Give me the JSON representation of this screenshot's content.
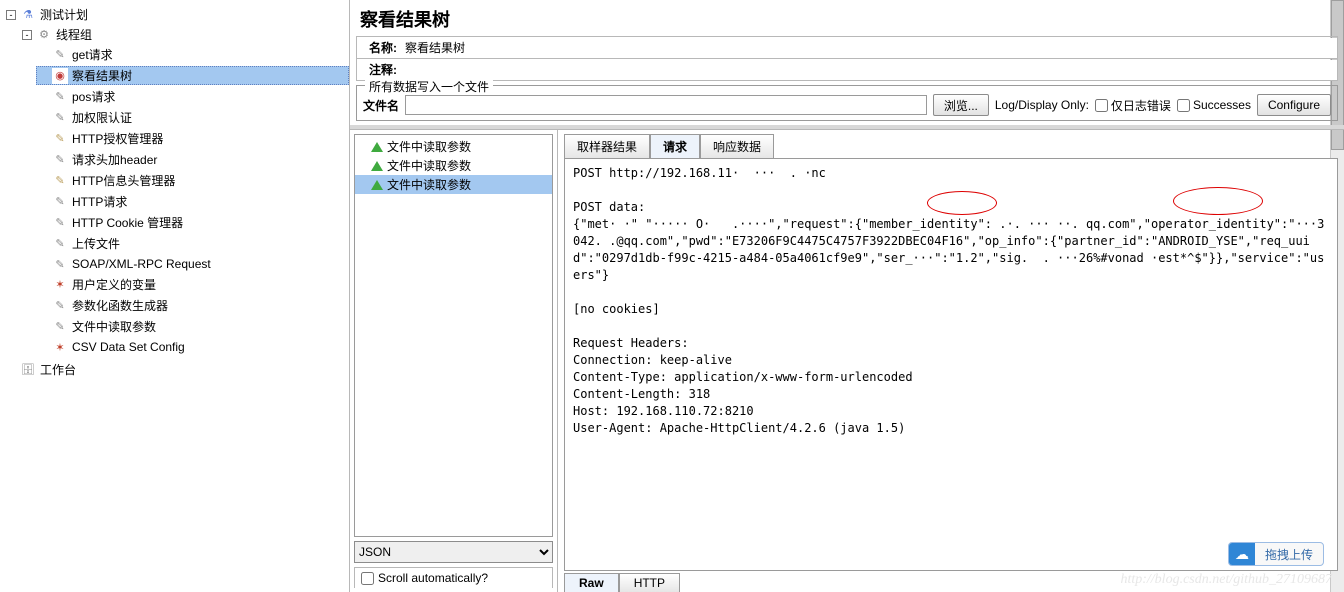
{
  "tree": {
    "root": "测试计划",
    "group": "线程组",
    "items": [
      "get请求",
      "察看结果树",
      "pos请求",
      "加权限认证",
      "HTTP授权管理器",
      "请求头加header",
      "HTTP信息头管理器",
      "HTTP请求",
      "HTTP Cookie 管理器",
      "上传文件",
      "SOAP/XML-RPC Request",
      "用户定义的变量",
      "参数化函数生成器",
      "文件中读取参数",
      "CSV Data Set Config"
    ],
    "workbench": "工作台"
  },
  "title": "察看结果树",
  "form": {
    "name_label": "名称:",
    "name_value": "察看结果树",
    "note_label": "注释:",
    "note_value": ""
  },
  "fileBox": {
    "legend": "所有数据写入一个文件",
    "fn_label": "文件名",
    "fn_value": "",
    "browse": "浏览...",
    "logOnly": "Log/Display Only:",
    "errOnly": "仅日志错误",
    "successes": "Successes",
    "configure": "Configure"
  },
  "samples": [
    "文件中读取参数",
    "文件中读取参数",
    "文件中读取参数"
  ],
  "sampleSelectedIndex": 2,
  "detailTabs": [
    "取样器结果",
    "请求",
    "响应数据"
  ],
  "activeTab": 1,
  "selectValue": "JSON",
  "scrollAuto": "Scroll automatically?",
  "rawTabs": [
    "Raw",
    "HTTP"
  ],
  "upload": "拖拽上传",
  "watermark": "http://blog.csdn.net/github_27109687",
  "request": {
    "line1": "POST http://192.168.11·  ···  . ·nc",
    "blank1": "",
    "line2": "POST data:",
    "line3": "{\"met· ·\" \"····· O·   .····\",\"request\":{\"member_identity\": .·. ··· ··. qq.com\",\"operator_identity\":\"···3042. .@qq.com\",\"pwd\":\"E73206F9C4475C4757F3922DBEC04F16\",\"op_info\":{\"partner_id\":\"ANDROID_YSE\",\"req_uuid\":\"0297d1db-f99c-4215-a484-05a4061cf9e9\",\"ser_···\":\"1.2\",\"sig.  . ···26%#vonad ·est*^$\"}},\"service\":\"users\"}",
    "blank2": "",
    "line4": "[no cookies]",
    "blank3": "",
    "line5": "Request Headers:",
    "line6": "Connection: keep-alive",
    "line7": "Content-Type: application/x-www-form-urlencoded",
    "line8": "Content-Length: 318",
    "line9": "Host: 192.168.110.72:8210",
    "line10": "User-Agent: Apache-HttpClient/4.2.6 (java 1.5)"
  }
}
